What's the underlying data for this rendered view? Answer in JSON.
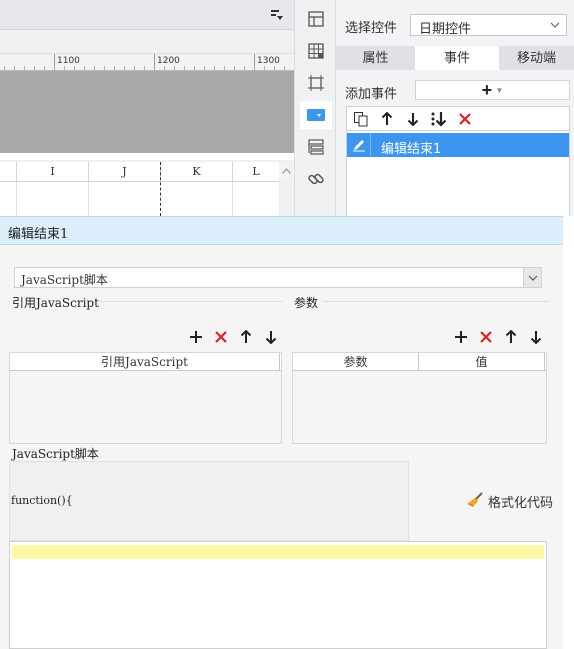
{
  "designer": {
    "ruler_labels": [
      "1100",
      "1200",
      "1300"
    ],
    "columns": [
      "I",
      "J",
      "K",
      "L"
    ]
  },
  "toolbar_icons": [
    "layout-icon",
    "table-grid-icon",
    "frame-icon",
    "widget-dropdown-icon",
    "list-stack-icon",
    "link-icon"
  ],
  "right_panel": {
    "select_control_label": "选择控件",
    "select_control_value": "日期控件",
    "tabs": [
      {
        "label": "属性",
        "active": false
      },
      {
        "label": "事件",
        "active": true
      },
      {
        "label": "移动端",
        "active": false
      }
    ],
    "add_event_label": "添加事件",
    "add_event_button": "+",
    "events": [
      {
        "label": "编辑结束1",
        "selected": true
      }
    ]
  },
  "dialog": {
    "title": "编辑结束1",
    "type_select_value": "JavaScript脚本",
    "ref_js": {
      "section_label": "引用JavaScript",
      "column_header": "引用JavaScript"
    },
    "params": {
      "section_label": "参数",
      "columns": [
        "参数",
        "值"
      ]
    },
    "script_section_label": "JavaScript脚本",
    "code_prefix": "function(){",
    "format_code_label": "格式化代码"
  },
  "colors": {
    "accent_blue": "#3c96f0",
    "delete_red": "#e02020",
    "dialog_header": "#dbeefa",
    "code_highlight": "#fffaa8"
  }
}
